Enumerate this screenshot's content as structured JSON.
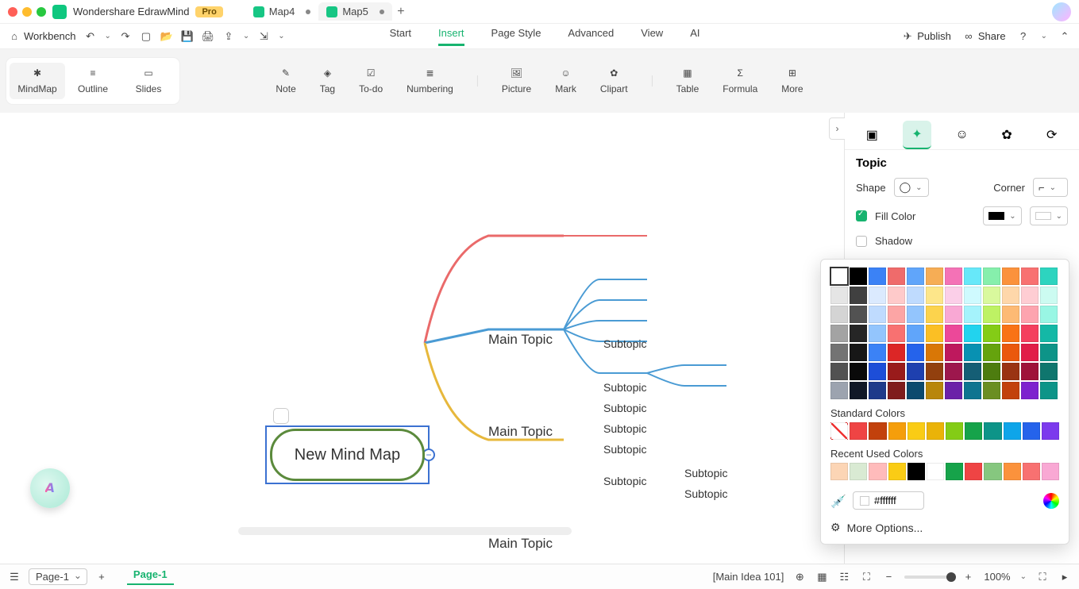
{
  "app": {
    "name": "Wondershare EdrawMind",
    "badge": "Pro"
  },
  "tabs": [
    {
      "label": "Map4",
      "active": false
    },
    {
      "label": "Map5",
      "active": true
    }
  ],
  "toolbar": {
    "workbench": "Workbench"
  },
  "menubar": {
    "start": "Start",
    "insert": "Insert",
    "page_style": "Page Style",
    "advanced": "Advanced",
    "view": "View",
    "ai": "AI",
    "publish": "Publish",
    "share": "Share"
  },
  "views": {
    "mindmap": "MindMap",
    "outline": "Outline",
    "slides": "Slides"
  },
  "ribbon": {
    "note": "Note",
    "tag": "Tag",
    "todo": "To-do",
    "numbering": "Numbering",
    "picture": "Picture",
    "mark": "Mark",
    "clipart": "Clipart",
    "table": "Table",
    "formula": "Formula",
    "more": "More"
  },
  "map": {
    "root": "New Mind Map",
    "main1": "Main Topic",
    "main2": "Main Topic",
    "main3": "Main Topic",
    "sub": "Subtopic"
  },
  "panel": {
    "title": "Topic",
    "shape": "Shape",
    "corner": "Corner",
    "fill": "Fill Color",
    "shadow": "Shadow"
  },
  "popup": {
    "std_label": "Standard Colors",
    "recent_label": "Recent Used Colors",
    "hex": "#ffffff",
    "more": "More Options..."
  },
  "palette_rows": [
    [
      "#ffffff",
      "#000000",
      "#3b82f6",
      "#ef6b6b",
      "#60a5fa",
      "#f6ad55",
      "#f472b6",
      "#67e8f9",
      "#86efac",
      "#fb923c",
      "#f87171",
      "#2dd4bf"
    ],
    [
      "#e5e5e5",
      "#404040",
      "#dbeafe",
      "#fecaca",
      "#bfdbfe",
      "#fde68a",
      "#fbcfe8",
      "#cffafe",
      "#d9f99d",
      "#fed7aa",
      "#fecdd3",
      "#ccfbf1"
    ],
    [
      "#d4d4d4",
      "#525252",
      "#bfdbfe",
      "#fca5a5",
      "#93c5fd",
      "#fcd34d",
      "#f9a8d4",
      "#a5f3fc",
      "#bef264",
      "#fdba74",
      "#fda4af",
      "#99f6e4"
    ],
    [
      "#a3a3a3",
      "#262626",
      "#93c5fd",
      "#f87171",
      "#60a5fa",
      "#fbbf24",
      "#ec4899",
      "#22d3ee",
      "#84cc16",
      "#f97316",
      "#f43f5e",
      "#14b8a6"
    ],
    [
      "#737373",
      "#171717",
      "#3b82f6",
      "#dc2626",
      "#2563eb",
      "#d97706",
      "#be185d",
      "#0891b2",
      "#65a30d",
      "#ea580c",
      "#e11d48",
      "#0d9488"
    ],
    [
      "#525252",
      "#0a0a0a",
      "#1d4ed8",
      "#991b1b",
      "#1e40af",
      "#92400e",
      "#9d174d",
      "#155e75",
      "#4d7c0f",
      "#9a3412",
      "#9f1239",
      "#0f766e"
    ],
    [
      "#9ca3af",
      "#111827",
      "#1e3a8a",
      "#7f1d1d",
      "#0c4a6e",
      "#b8860b",
      "#6b21a8",
      "#0e7490",
      "#6b8e23",
      "#c2410c",
      "#7e22ce",
      "#0d9488"
    ]
  ],
  "standard_colors": [
    "none",
    "#ef4444",
    "#c2410c",
    "#f59e0b",
    "#facc15",
    "#eab308",
    "#84cc16",
    "#16a34a",
    "#0d9488",
    "#0ea5e9",
    "#2563eb",
    "#7c3aed"
  ],
  "recent_colors": [
    "#fcd5b5",
    "#d9ead3",
    "#fbb",
    "#facc15",
    "#000000",
    "#ffffff",
    "#16a34a",
    "#ef4444",
    "#86c77f",
    "#fb923c",
    "#f87171",
    "#f9a8d4"
  ],
  "status": {
    "page_picker": "Page-1",
    "page_active": "Page-1",
    "selection": "[Main Idea 101]",
    "zoom": "100%"
  }
}
